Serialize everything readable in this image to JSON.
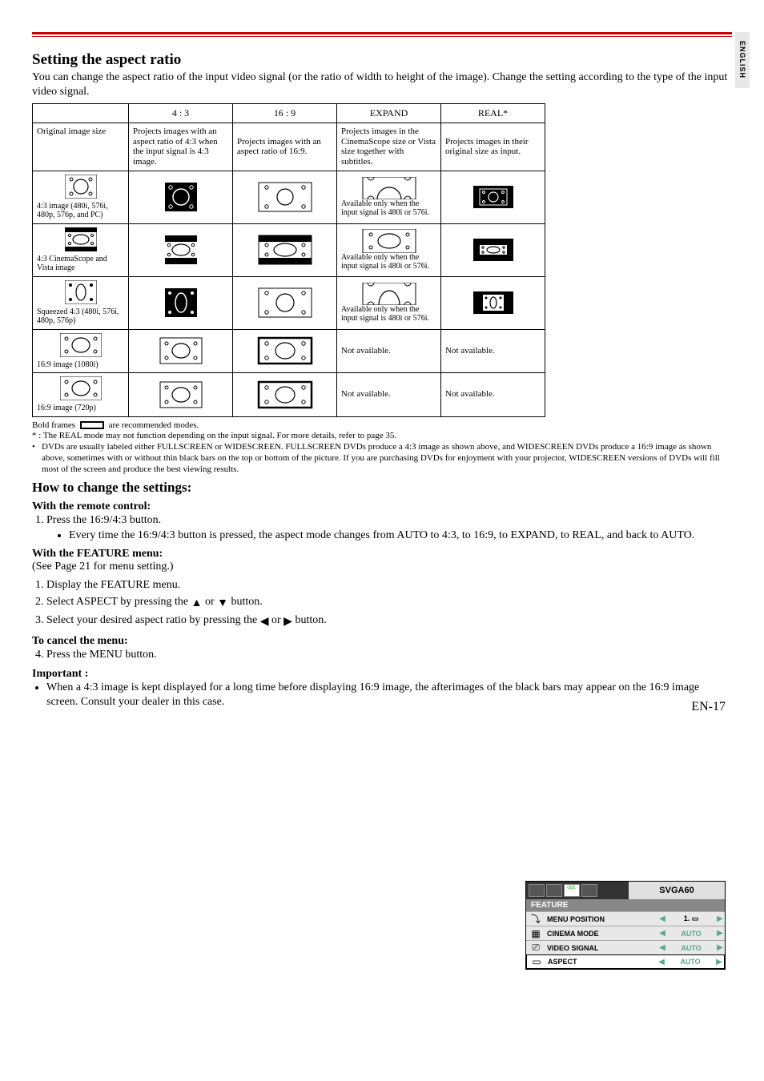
{
  "sideTab": "ENGLISH",
  "sectionTitle": "Setting the aspect ratio",
  "intro": "You can change the aspect ratio of the input video signal (or the ratio of width to height of the image). Change the setting according to the type of the input video signal.",
  "table": {
    "headers": [
      "",
      "4 : 3",
      "16 : 9",
      "EXPAND",
      "REAL*"
    ],
    "row1": {
      "label": "Original image size",
      "c43": "Projects images with an aspect ratio of 4:3 when the input signal is 4:3 image.",
      "c169": "Projects images with an aspect ratio of 16:9.",
      "cexp": "Projects images in the CinemaScope size or Vista size together with subtitles.",
      "creal": "Projects images in their original size as input."
    },
    "rowA": {
      "label": "4:3 image (480i, 576i, 480p, 576p, and PC)",
      "note": "Available only when the input signal is 480i or 576i."
    },
    "rowB": {
      "label": "4:3 CinemaScope and Vista image",
      "note": "Available only when the input signal is 480i or 576i."
    },
    "rowC": {
      "label": "Squeezed 4:3 (480i, 576i, 480p, 576p)",
      "note": "Available only when the input signal is 480i or 576i."
    },
    "rowD": {
      "label": "16:9 image (1080i)",
      "exp": "Not available.",
      "real": "Not available."
    },
    "rowE": {
      "label": "16:9 image (720p)",
      "exp": "Not available.",
      "real": "Not available."
    }
  },
  "footnotes": {
    "legend": "Bold frames          are recommended modes.",
    "star": "* : The REAL mode may not function depending on the input signal. For more details, refer to page 35.",
    "bullet": "DVDs are usually labeled either FULLSCREEN or WIDESCREEN. FULLSCREEN DVDs produce a 4:3 image as shown above, and WIDESCREEN DVDs produce a 16:9 image as shown above, sometimes with or without thin black bars on the top or bottom of the picture. If you are purchasing DVDs for enjoyment with your projector, WIDESCREEN versions of DVDs will fill most of the screen and produce the best viewing results."
  },
  "howTo": {
    "title": "How to change the settings:",
    "remoteTitle": "With the remote control:",
    "remoteStep1": "Press the 16:9/4:3 button.",
    "remoteBullet": "Every time the 16:9/4:3 button is pressed, the aspect mode changes from AUTO to 4:3, to 16:9, to EXPAND, to REAL, and back to AUTO.",
    "featureTitle": "With the FEATURE menu:",
    "featureSee": "(See Page 21 for menu setting.)",
    "fStep1": "Display the FEATURE menu.",
    "fStep2": "Select ASPECT by pressing the ▲ or ▼ button.",
    "fStep3": "Select your desired aspect ratio by pressing the ◀ or ▶ button.",
    "cancelTitle": "To cancel the menu:",
    "cancelStep": "Press the MENU button.",
    "importantTitle": "Important :",
    "importantBullet": "When a 4:3 image is kept displayed for a long time before displaying 16:9 image, the afterimages of the black bars may appear on the 16:9 image screen. Consult your dealer in this case."
  },
  "featureBox": {
    "signal": "SVGA60",
    "title": "FEATURE",
    "rows": [
      {
        "name": "MENU POSITION",
        "val": "1."
      },
      {
        "name": "CINEMA MODE",
        "val": "AUTO"
      },
      {
        "name": "VIDEO SIGNAL",
        "val": "AUTO"
      },
      {
        "name": "ASPECT",
        "val": "AUTO"
      }
    ]
  },
  "pageNum": "EN-17"
}
